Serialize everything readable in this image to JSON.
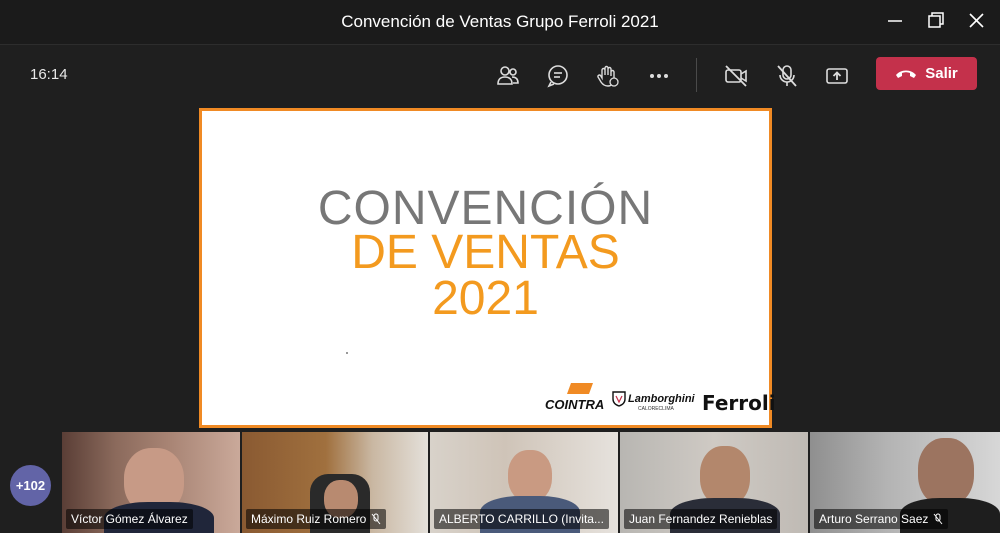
{
  "window": {
    "title": "Convención de Ventas Grupo Ferroli 2021"
  },
  "toolbar": {
    "clock": "16:14",
    "buttons": [
      "participants-icon",
      "chat-icon",
      "raise-hand-icon",
      "more-icon",
      "camera-off-icon",
      "mic-off-icon",
      "share-icon"
    ],
    "leave_label": "Salir",
    "leave_color": "#c4314b"
  },
  "slide": {
    "line1": "CONVENCIÓN",
    "line2": "DE VENTAS",
    "line3": "2021",
    "logos": {
      "cointra": "COINTRA",
      "lamborghini": "Lamborghini",
      "lamborghini_sub": "CALORECLIMA",
      "ferroli": "Ferroli"
    },
    "accent": "#f39a1f",
    "border": "#f08a24"
  },
  "participants": {
    "overflow": "+102",
    "tiles": [
      {
        "name": "Víctor Gómez Álvarez",
        "muted": false
      },
      {
        "name": "Máximo Ruiz Romero",
        "muted": true
      },
      {
        "name": "ALBERTO CARRILLO (Invita...",
        "muted": true
      },
      {
        "name": "Juan Fernandez Renieblas",
        "muted": false
      },
      {
        "name": "Arturo Serrano Saez",
        "muted": true
      }
    ]
  }
}
